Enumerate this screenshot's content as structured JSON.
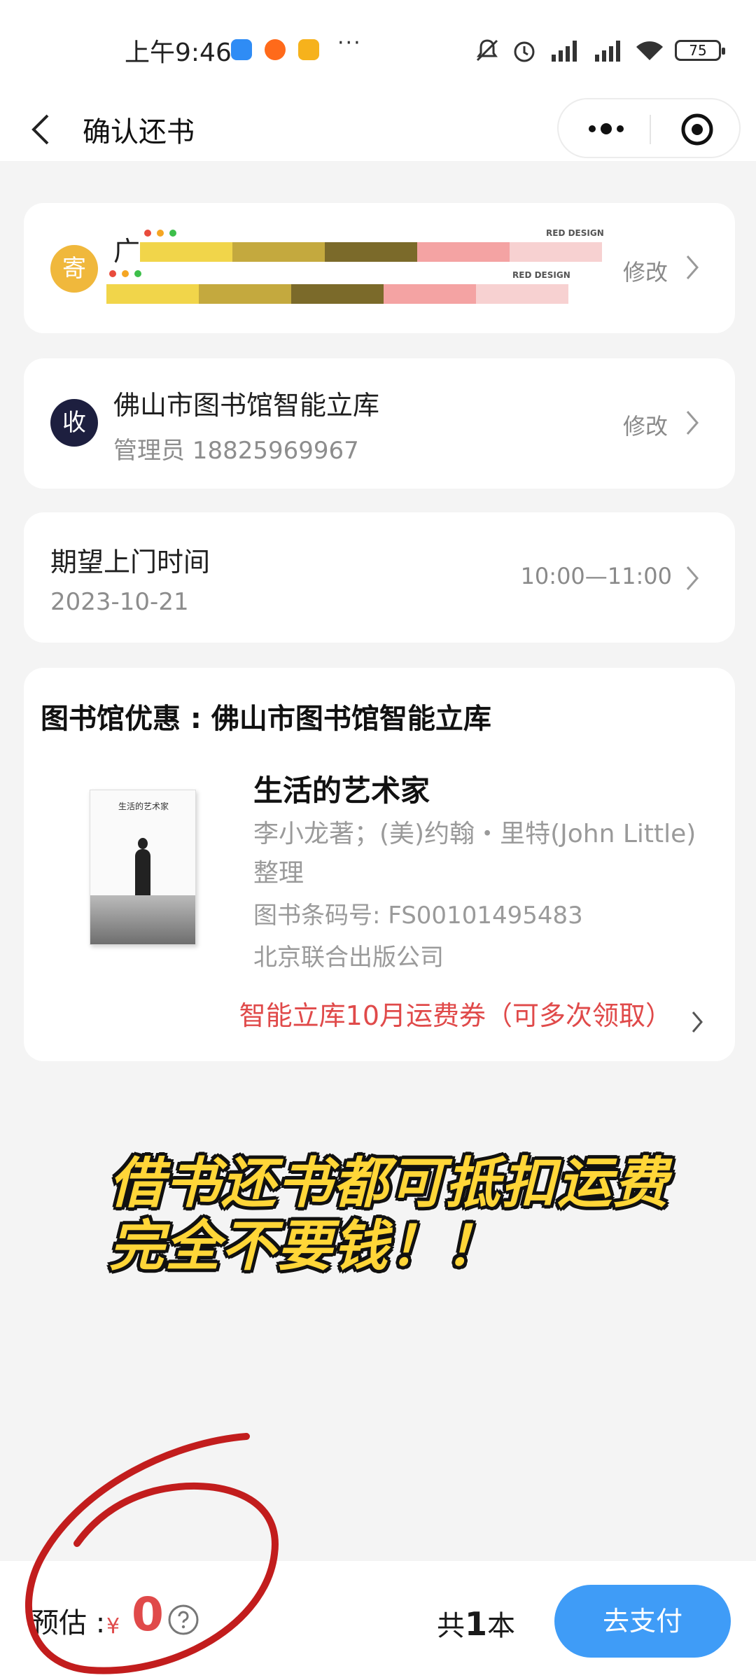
{
  "status_bar": {
    "time": "上午9:46",
    "dots": "···",
    "battery": "75"
  },
  "nav": {
    "title": "确认还书"
  },
  "sender": {
    "badge": "寄",
    "edit_label": "修改",
    "redaction_label": "RED DESIGN"
  },
  "receiver": {
    "badge": "收",
    "name": "佛山市图书馆智能立库",
    "contact": "管理员 18825969967",
    "edit_label": "修改"
  },
  "pickup": {
    "title": "期望上门时间",
    "date": "2023-10-21",
    "slot": "10:00—11:00"
  },
  "library": {
    "title": "图书馆优惠 : 佛山市图书馆智能立库",
    "book": {
      "cover_title": "生活的艺术家",
      "title": "生活的艺术家",
      "author": "李小龙著；(美)约翰・里特(John Little)整理",
      "barcode": "图书条码号: FS00101495483",
      "publisher": "北京联合出版公司"
    },
    "coupon": "智能立库10月运费券（可多次领取）"
  },
  "overlay": {
    "line1": "借书还书都可抵扣运费",
    "line2": "完全不要钱！！"
  },
  "bottom": {
    "estimate_label": "预估 :",
    "currency": "¥",
    "estimate_value": "0",
    "count_prefix": "共",
    "count_value": "1",
    "count_suffix": "本",
    "pay_label": "去支付"
  },
  "colors": {
    "accent_blue": "#3f9cf7",
    "price_red": "#e04a4a",
    "sender_badge": "#f0b83c",
    "receiver_badge": "#1d1f3f"
  }
}
